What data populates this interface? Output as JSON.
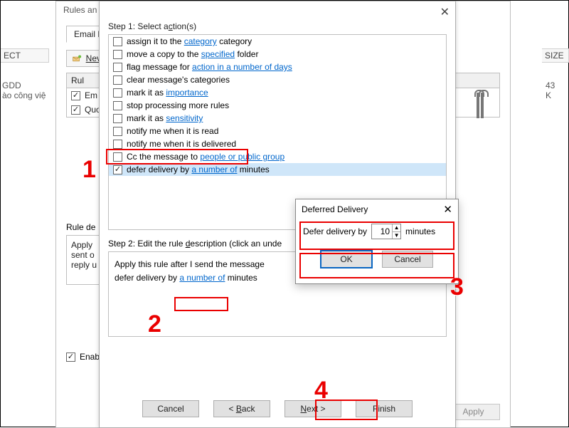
{
  "bg": {
    "col_subject": "ECT",
    "col_size": "SIZE",
    "msg_line1": "GDD",
    "msg_line2": "ào công việ",
    "msg_size": "43 K"
  },
  "rules": {
    "title": "Rules an",
    "tab": "Email Ru",
    "new_label": "Nev",
    "th": "Rul",
    "row1": "Em",
    "row2": "Quo",
    "desc_label": "Rule de",
    "desc_l1": "Apply",
    "desc_l2": "sent o",
    "desc_l3": "reply u",
    "enable_label": "Enab",
    "apply_label": "Apply"
  },
  "wiz": {
    "step1_label": "Step 1: Select action(s)",
    "close": "✕",
    "actions": {
      "a0_pre": "assign it to the ",
      "a0_link": "category",
      "a0_post": " category",
      "a1_pre": "move a copy to the ",
      "a1_link": "specified",
      "a1_post": " folder",
      "a2_pre": "flag message for ",
      "a2_link": "action in a number of days",
      "a3": "clear message's categories",
      "a4_pre": "mark it as ",
      "a4_link": "importance",
      "a5": "stop processing more rules",
      "a6_pre": "mark it as ",
      "a6_link": "sensitivity",
      "a7": "notify me when it is read",
      "a8": "notify me when it is delivered",
      "a9_pre": "Cc the message to ",
      "a9_link": "people or public group",
      "a10_pre": "defer delivery by ",
      "a10_link": "a number of",
      "a10_post": " minutes"
    },
    "step2_label": "Step 2: Edit the rule description (click an unde",
    "desc_l1": "Apply this rule after I send the message",
    "desc_l2_pre": "defer delivery by ",
    "desc_l2_link": "a number of",
    "desc_l2_post": " minutes",
    "btn_cancel": "Cancel",
    "btn_back": "< Back",
    "btn_next": "Next >",
    "btn_finish": "Finish",
    "btn_next_underline": "N"
  },
  "defer": {
    "title": "Deferred Delivery",
    "close": "✕",
    "label_pre": "Defer delivery by",
    "value": "10",
    "label_post": "minutes",
    "ok": "OK",
    "cancel": "Cancel"
  },
  "ann": {
    "n1": "1",
    "n2": "2",
    "n3": "3",
    "n4": "4"
  }
}
